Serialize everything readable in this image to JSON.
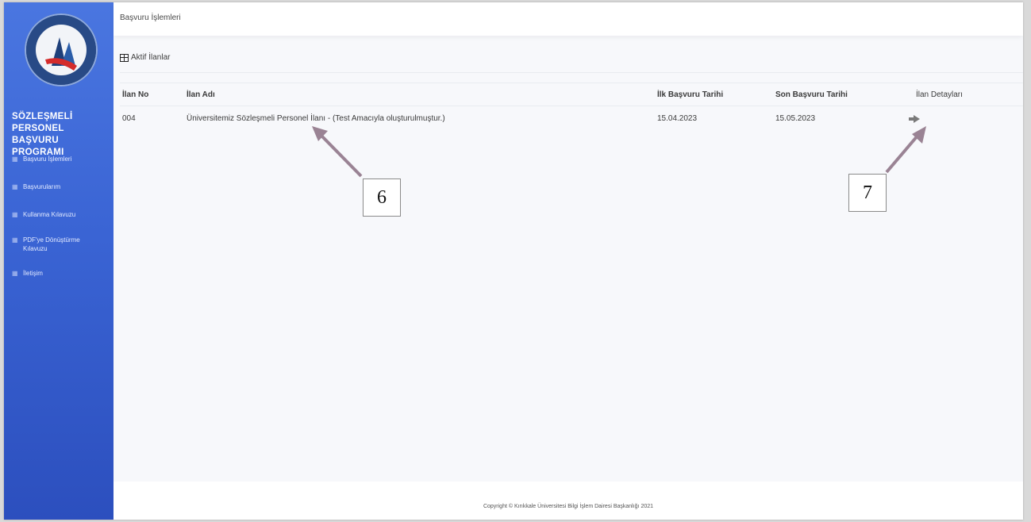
{
  "sidebar": {
    "brand": "SÖZLEŞMELİ PERSONEL BAŞVURU PROGRAMI",
    "items": [
      {
        "label": "Başvuru İşlemleri"
      },
      {
        "label": "Başvurularım"
      },
      {
        "label": "Kullanma Kılavuzu"
      },
      {
        "label": "PDF'ye Dönüştürme Kılavuzu"
      },
      {
        "label": "İletişim"
      }
    ]
  },
  "header": {
    "breadcrumb": "Başvuru İşlemleri"
  },
  "card": {
    "title": "Aktif İlanlar"
  },
  "table": {
    "columns": [
      "İlan No",
      "İlan Adı",
      "İlk Başvuru Tarihi",
      "Son Başvuru Tarihi",
      "İlan Detayları"
    ],
    "rows": [
      {
        "no": "004",
        "name": "Üniversitemiz Sözleşmeli Personel İlanı - (Test Amacıyla oluşturulmuştur.)",
        "first_date": "15.04.2023",
        "last_date": "15.05.2023"
      }
    ]
  },
  "annotations": {
    "callout_6": "6",
    "callout_7": "7"
  },
  "footer": {
    "copyright": "Copyright © Kırıkkale Üniversitesi Bilgi İşlem Dairesi Başkanlığı 2021"
  },
  "colors": {
    "sidebar": "#3a64d4",
    "arrow": "#9a8394",
    "logo_ring": "#2f4f8e"
  }
}
